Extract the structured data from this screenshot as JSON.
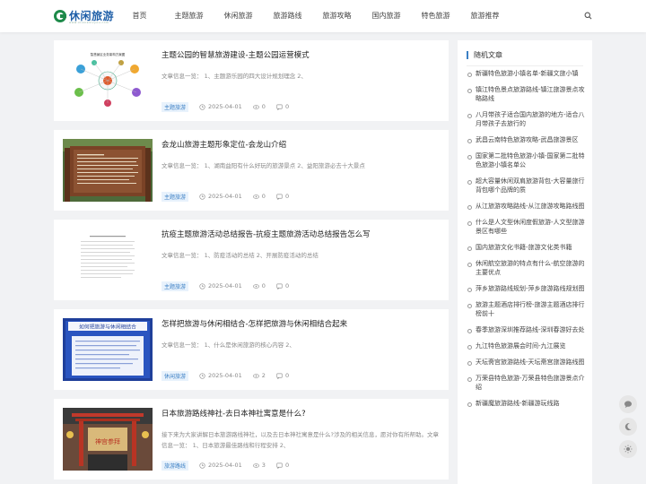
{
  "header": {
    "logo_text": "休闲旅游",
    "logo_sub": "www.xiuxianlvyou.com",
    "nav": [
      "首页",
      "主题旅游",
      "休闲旅游",
      "旅游路线",
      "旅游攻略",
      "国内旅游",
      "特色旅游",
      "旅游推荐"
    ]
  },
  "articles": [
    {
      "title": "主题公园的智慧旅游建设-主题公园运营模式",
      "excerpt": "文章信息一览： 1、主题游乐园的四大设计规划理念 2、",
      "tag": "主题旅游",
      "date": "2025-04-01",
      "views": "0",
      "comments": "0",
      "thumb_caption": "智慧景区业务架构方案图"
    },
    {
      "title": "会龙山旅游主题形象定位-会龙山介绍",
      "excerpt": "文章信息一览： 1、湖南益阳有什么好玩的旅游景点 2、益阳旅游必去十大景点",
      "tag": "主题旅游",
      "date": "2025-04-01",
      "views": "0",
      "comments": "0",
      "thumb_caption": ""
    },
    {
      "title": "抗疫主题旅游活动总结报告-抗疫主题旅游活动总结报告怎么写",
      "excerpt": "文章信息一览： 1、防疫活动的总结 2、开展防疫活动的总结",
      "tag": "主题旅游",
      "date": "2025-04-01",
      "views": "0",
      "comments": "0",
      "thumb_caption": ""
    },
    {
      "title": "怎样把旅游与休闲相结合-怎样把旅游与休闲相结合起来",
      "excerpt": "文章信息一览： 1、什么是休闲旅游的核心内容 2、",
      "tag": "休闲旅游",
      "date": "2025-04-01",
      "views": "2",
      "comments": "0",
      "thumb_caption": "如何把旅游与休闲相结合"
    },
    {
      "title": "日本旅游路线神社-去日本神社寓意是什么?",
      "excerpt": "接下来为大家讲解日本旅游路线神社，以及去日本神社寓意是什么?涉及的相关信息，愿对你有所帮助。文章信息一览： 1、日本旅游最佳路线和行程安排 2、",
      "tag": "旅游路线",
      "date": "2025-04-01",
      "views": "3",
      "comments": "0",
      "thumb_caption": "神宫参拜"
    }
  ],
  "sidebar": {
    "title": "随机文章",
    "items": [
      "新疆特色旅游小镇名单-新疆文旅小镇",
      "镇江特色景点旅游路线-镇江旅游景点攻略路线",
      "八月带孩子适合国内旅游的地方-适合八月带孩子去旅行的",
      "武昌云南特色旅游攻略-武昌旅游景区",
      "国家第二批特色旅游小镇-国家第二批特色旅游小镇名单公",
      "超大容量休闲双肩旅游背包-大容量旅行背包哪个品牌的质",
      "从江旅游攻略路线-从江旅游攻略路线图",
      "什么是人文型休闲度假旅游-人文型旅游景区有哪些",
      "国内旅游文化书籍-旅游文化类书籍",
      "休闲航空旅游的特点有什么-航空旅游的主要优点",
      "萍乡旅游路线规划-萍乡旅游路线规划图",
      "旅游主题酒店排行榜-旅游主题酒店排行榜前十",
      "春季旅游深圳推荐路线-深圳春游好去处",
      "九江特色旅游展会时间-九江展览",
      "天坛斋宫旅游路线-天坛斋宫旅游路线图",
      "万荣县特色旅游-万荣县特色旅游景点介绍",
      "新疆魔旅游路线-新疆游玩线路"
    ]
  },
  "colors": {
    "accent": "#3b7fc4",
    "tag_bg": "#e8f2fc",
    "logo_green": "#1e8a4a",
    "logo_blue": "#1f5fa8"
  },
  "icons": {
    "search": "search-icon",
    "time": "clock-icon",
    "views": "eye-icon",
    "comments": "comment-icon",
    "float": [
      "chat-icon",
      "moon-icon",
      "sun-icon"
    ]
  }
}
